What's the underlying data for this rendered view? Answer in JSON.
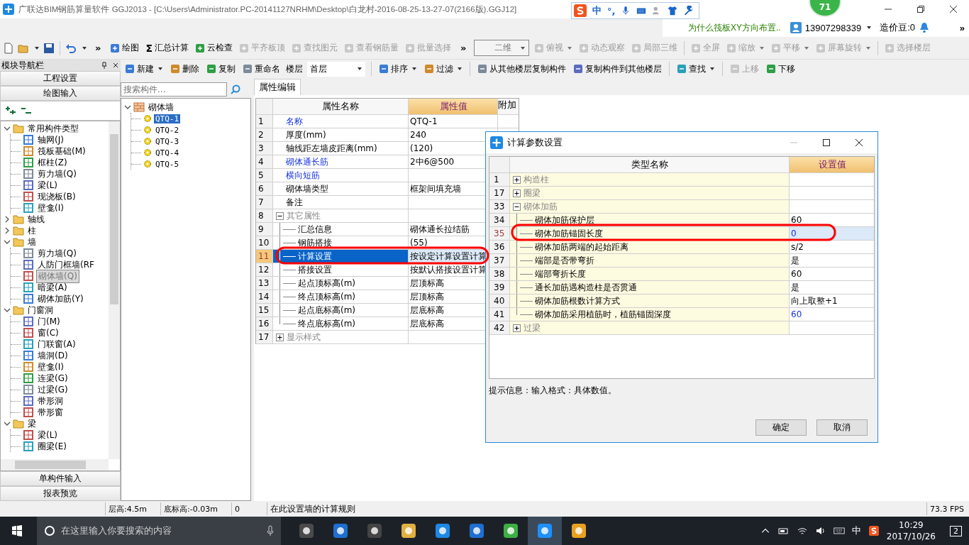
{
  "title_bar": {
    "title": "广联达BIM钢筋算量软件 GGJ2013 - [C:\\Users\\Administrator.PC-20141127NRHM\\Desktop\\白龙村-2016-08-25-13-27-07(2166版).GGJ12]"
  },
  "notification_badge": "71",
  "ime_bar": {
    "mode": "中",
    "punct": "°,"
  },
  "account_bar": {
    "news": "为什么筏板XY方向布置..",
    "phone": "13907298339",
    "beans": "造价豆:0",
    "overflow": "»"
  },
  "main_toolbar": {
    "overflow": "»",
    "items": [
      {
        "kind": "button",
        "label": "绘图",
        "disabled": false,
        "dropdown": false
      },
      {
        "kind": "button",
        "glyph": "Σ",
        "label": "汇总计算",
        "disabled": false,
        "dropdown": false
      },
      {
        "kind": "button",
        "label": "云检查",
        "disabled": false,
        "dropdown": false
      },
      {
        "kind": "button",
        "label": "平齐板顶",
        "disabled": true,
        "dropdown": false
      },
      {
        "kind": "button",
        "label": "查找图元",
        "disabled": true,
        "dropdown": false
      },
      {
        "kind": "button",
        "label": "查看钢筋量",
        "disabled": true,
        "dropdown": false
      },
      {
        "kind": "button",
        "label": "批量选择",
        "disabled": true,
        "dropdown": false
      },
      {
        "kind": "overflow",
        "label": "»"
      },
      {
        "kind": "select",
        "label": "二维"
      },
      {
        "kind": "button",
        "label": "俯视",
        "disabled": true,
        "dropdown": true
      },
      {
        "kind": "button",
        "label": "动态观察",
        "disabled": true,
        "dropdown": false
      },
      {
        "kind": "button",
        "label": "局部三维",
        "disabled": true,
        "dropdown": false
      },
      {
        "kind": "separator"
      },
      {
        "kind": "button",
        "label": "全屏",
        "disabled": true,
        "dropdown": false
      },
      {
        "kind": "button",
        "label": "缩放",
        "disabled": true,
        "dropdown": true
      },
      {
        "kind": "button",
        "label": "平移",
        "disabled": true,
        "dropdown": true
      },
      {
        "kind": "button",
        "label": "屏幕旋转",
        "disabled": true,
        "dropdown": true
      },
      {
        "kind": "separator"
      },
      {
        "kind": "button",
        "label": "选择楼层",
        "disabled": true,
        "dropdown": false
      }
    ]
  },
  "nav": {
    "title": "模块导航栏",
    "top_sections": [
      "工程设置",
      "绘图输入"
    ],
    "bottom_sections": [
      "单构件输入",
      "报表预览"
    ],
    "tree": [
      {
        "label": "常用构件类型",
        "expanded": true,
        "selected": false,
        "children": [
          {
            "label": "轴网(J)",
            "selected": false
          },
          {
            "label": "筏板基础(M)",
            "selected": false
          },
          {
            "label": "框柱(Z)",
            "selected": false
          },
          {
            "label": "剪力墙(Q)",
            "selected": false
          },
          {
            "label": "梁(L)",
            "selected": false
          },
          {
            "label": "现浇板(B)",
            "selected": false
          },
          {
            "label": "壁龛(I)",
            "selected": false
          }
        ]
      },
      {
        "label": "轴线",
        "expanded": false,
        "selected": false
      },
      {
        "label": "柱",
        "expanded": false,
        "selected": false
      },
      {
        "label": "墙",
        "expanded": true,
        "selected": false,
        "children": [
          {
            "label": "剪力墙(Q)",
            "selected": false
          },
          {
            "label": "人防门框墙(RF",
            "selected": false
          },
          {
            "label": "砌体墙(Q)",
            "selected": true
          },
          {
            "label": "暗梁(A)",
            "selected": false
          },
          {
            "label": "砌体加筋(Y)",
            "selected": false
          }
        ]
      },
      {
        "label": "门窗洞",
        "expanded": true,
        "selected": false,
        "children": [
          {
            "label": "门(M)",
            "selected": false
          },
          {
            "label": "窗(C)",
            "selected": false
          },
          {
            "label": "门联窗(A)",
            "selected": false
          },
          {
            "label": "墙洞(D)",
            "selected": false
          },
          {
            "label": "壁龛(I)",
            "selected": false
          },
          {
            "label": "连梁(G)",
            "selected": false
          },
          {
            "label": "过梁(G)",
            "selected": false
          },
          {
            "label": "带形洞",
            "selected": false
          },
          {
            "label": "带形窗",
            "selected": false
          }
        ]
      },
      {
        "label": "梁",
        "expanded": true,
        "selected": false,
        "children": [
          {
            "label": "梁(L)",
            "selected": false
          },
          {
            "label": "圈梁(E)",
            "selected": false
          }
        ]
      }
    ]
  },
  "edit_toolbar": {
    "items": [
      {
        "kind": "button",
        "label": "新建",
        "disabled": false,
        "dropdown": true
      },
      {
        "kind": "button",
        "label": "删除",
        "disabled": false,
        "dropdown": false
      },
      {
        "kind": "button",
        "label": "复制",
        "disabled": false,
        "dropdown": false
      },
      {
        "kind": "button",
        "label": "重命名",
        "disabled": false,
        "dropdown": false
      },
      {
        "kind": "label",
        "label": "楼层"
      },
      {
        "kind": "select",
        "label": "首层"
      },
      {
        "kind": "separator"
      },
      {
        "kind": "button",
        "label": "排序",
        "disabled": false,
        "dropdown": true
      },
      {
        "kind": "button",
        "label": "过滤",
        "disabled": false,
        "dropdown": true
      },
      {
        "kind": "separator"
      },
      {
        "kind": "button",
        "label": "从其他楼层复制构件",
        "disabled": false,
        "dropdown": false
      },
      {
        "kind": "button",
        "label": "复制构件到其他楼层",
        "disabled": false,
        "dropdown": false
      },
      {
        "kind": "separator"
      },
      {
        "kind": "button",
        "label": "查找",
        "disabled": false,
        "dropdown": true
      },
      {
        "kind": "separator"
      },
      {
        "kind": "button",
        "label": "上移",
        "disabled": true,
        "dropdown": false
      },
      {
        "kind": "button",
        "label": "下移",
        "disabled": false,
        "dropdown": false
      }
    ]
  },
  "component_list": {
    "search_placeholder": "搜索构件...",
    "root": {
      "label": "砌体墙",
      "expanded": true,
      "children": [
        {
          "label": "QTQ-1",
          "selected": true
        },
        {
          "label": "QTQ-2",
          "selected": false
        },
        {
          "label": "QTQ-3",
          "selected": false
        },
        {
          "label": "QTQ-4",
          "selected": false
        },
        {
          "label": "QTQ-5",
          "selected": false
        }
      ]
    }
  },
  "properties": {
    "tab": "属性编辑",
    "columns": [
      "属性名称",
      "属性值",
      "附加"
    ],
    "rows": [
      {
        "no": "1",
        "kind": "item",
        "name": "名称",
        "value": "QTQ-1",
        "link": true,
        "selected": false
      },
      {
        "no": "2",
        "kind": "item",
        "name": "厚度(mm)",
        "value": "240",
        "link": false,
        "selected": false
      },
      {
        "no": "3",
        "kind": "item",
        "name": "轴线距左墙皮距离(mm)",
        "value": "(120)",
        "link": false,
        "selected": false
      },
      {
        "no": "4",
        "kind": "item",
        "name": "砌体通长筋",
        "value": "2中6@500",
        "link": true,
        "selected": false
      },
      {
        "no": "5",
        "kind": "item",
        "name": "横向短筋",
        "link": true,
        "selected": false
      },
      {
        "no": "6",
        "kind": "item",
        "name": "砌体墙类型",
        "value": "框架间填充墙",
        "link": false,
        "selected": false
      },
      {
        "no": "7",
        "kind": "item",
        "name": "备注",
        "link": false,
        "selected": false
      },
      {
        "no": "8",
        "kind": "group",
        "name": "其它属性",
        "expanded": true,
        "selected": false,
        "children": [
          {
            "no": "9",
            "kind": "item",
            "name": "汇总信息",
            "value": "砌体通长拉结筋",
            "link": false,
            "selected": false
          },
          {
            "no": "10",
            "kind": "item",
            "name": "钢筋搭接",
            "value": "(55)",
            "link": false,
            "selected": false
          },
          {
            "no": "11",
            "kind": "item",
            "name": "计算设置",
            "value": "按设定计算设置计算",
            "link": false,
            "selected": true
          },
          {
            "no": "12",
            "kind": "item",
            "name": "搭接设置",
            "value": "按默认搭接设置计算",
            "link": false,
            "selected": false
          },
          {
            "no": "13",
            "kind": "item",
            "name": "起点顶标高(m)",
            "value": "层顶标高",
            "link": false,
            "selected": false
          },
          {
            "no": "14",
            "kind": "item",
            "name": "终点顶标高(m)",
            "value": "层顶标高",
            "link": false,
            "selected": false
          },
          {
            "no": "15",
            "kind": "item",
            "name": "起点底标高(m)",
            "value": "层底标高",
            "link": false,
            "selected": false
          },
          {
            "no": "16",
            "kind": "item",
            "name": "终点底标高(m)",
            "value": "层底标高",
            "link": false,
            "selected": false
          }
        ]
      },
      {
        "no": "17",
        "kind": "group",
        "name": "显示样式",
        "expanded": false,
        "selected": false
      }
    ]
  },
  "dialog": {
    "title": "计算参数设置",
    "columns": [
      "类型名称",
      "设置值"
    ],
    "rows": [
      {
        "no": "1",
        "kind": "group",
        "name": "构造柱",
        "expanded": false,
        "selected": false
      },
      {
        "no": "17",
        "kind": "group",
        "name": "圈梁",
        "expanded": false,
        "selected": false
      },
      {
        "no": "33",
        "kind": "group",
        "name": "砌体加筋",
        "expanded": true,
        "selected": false,
        "children": [
          {
            "no": "34",
            "kind": "item",
            "name": "砌体加筋保护层",
            "value": "60",
            "modified": false,
            "selected": false
          },
          {
            "no": "35",
            "kind": "item",
            "name": "砌体加筋锚固长度",
            "value": "0",
            "modified": true,
            "selected": true
          },
          {
            "no": "36",
            "kind": "item",
            "name": "砌体加筋两端的起始距离",
            "value": "s/2",
            "modified": false,
            "selected": false
          },
          {
            "no": "37",
            "kind": "item",
            "name": "端部是否带弯折",
            "value": "是",
            "modified": false,
            "selected": false
          },
          {
            "no": "38",
            "kind": "item",
            "name": "端部弯折长度",
            "value": "60",
            "modified": false,
            "selected": false
          },
          {
            "no": "39",
            "kind": "item",
            "name": "通长加筋遇构造柱是否贯通",
            "value": "是",
            "modified": false,
            "selected": false
          },
          {
            "no": "40",
            "kind": "item",
            "name": "砌体加筋根数计算方式",
            "value": "向上取整+1",
            "modified": false,
            "selected": false
          },
          {
            "no": "41",
            "kind": "item",
            "name": "砌体加筋采用植筋时，植筋锚固深度",
            "value": "60",
            "modified": true,
            "selected": false
          }
        ]
      },
      {
        "no": "42",
        "kind": "group",
        "name": "过梁",
        "expanded": false,
        "selected": false
      }
    ],
    "hint": "提示信息：输入格式：具体数值。",
    "buttons": [
      "确定",
      "取消"
    ]
  },
  "status_bar": {
    "cells": [
      "层高:4.5m",
      "底标高:-0.03m",
      "0",
      "在此设置墙的计算规则"
    ],
    "fps": "73.3 FPS"
  },
  "taskbar": {
    "search_placeholder": "在这里输入你要搜索的内容",
    "input_method": "中",
    "time": "10:29",
    "date": "2017/10/26",
    "notifications": "2"
  }
}
